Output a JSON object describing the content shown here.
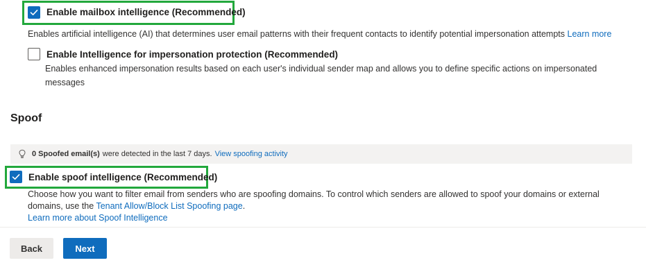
{
  "mailbox_intelligence": {
    "checked": true,
    "label": "Enable mailbox intelligence (Recommended)",
    "description": "Enables artificial intelligence (AI) that determines user email patterns with their frequent contacts to identify potential impersonation attempts",
    "learn_more": "Learn more"
  },
  "impersonation_intelligence": {
    "checked": false,
    "label": "Enable Intelligence for impersonation protection (Recommended)",
    "description_line1": "Enables enhanced impersonation results based on each user's individual sender map and allows you to define specific actions on impersonated",
    "description_line2": "messages"
  },
  "spoof": {
    "title": "Spoof",
    "info": {
      "count_text": "0 Spoofed email(s)",
      "rest_text": "were detected in the last 7 days.",
      "link": "View spoofing activity"
    },
    "spoof_intelligence": {
      "checked": true,
      "label": "Enable spoof intelligence (Recommended)",
      "description_line1": "Choose how you want to filter email from senders who are spoofing domains. To control which senders are allowed to spoof your domains or external",
      "description_line2_prefix": "domains, use the",
      "description_line2_link": "Tenant Allow/Block List Spoofing page",
      "description_line2_suffix": ".",
      "learn_more": "Learn more about Spoof Intelligence"
    }
  },
  "footer": {
    "back_label": "Back",
    "next_label": "Next"
  },
  "colors": {
    "accent": "#0f6cbd",
    "highlight": "#22a83c"
  }
}
